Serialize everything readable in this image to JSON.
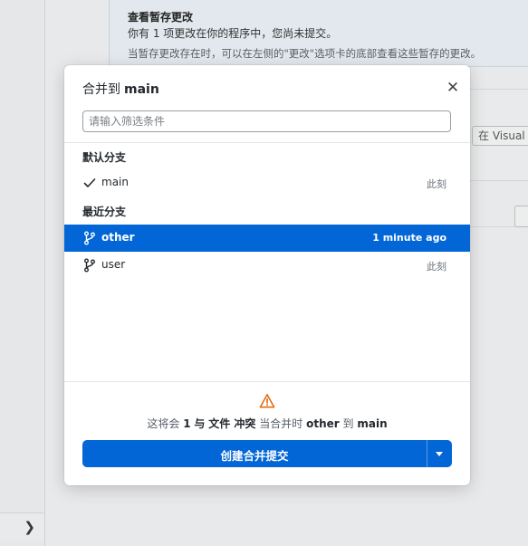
{
  "background": {
    "stash_title": "查看暂存更改",
    "stash_line1": "你有 1 项更改在你的程序中，您尚未提交。",
    "stash_line2": "当暂存更改存在时，可以在左侧的\"更改\"选项卡的底部查看这些暂存的更改。",
    "open_in_editor_label": "在 Visual S"
  },
  "dialog": {
    "title_prefix": "合并到",
    "title_branch": "main",
    "filter_placeholder": "请输入筛选条件",
    "default_group_label": "默认分支",
    "recent_group_label": "最近分支",
    "default_branches": [
      {
        "name": "main",
        "time": "此刻",
        "icon": "check-icon"
      }
    ],
    "recent_branches": [
      {
        "name": "other",
        "time": "1 minute ago",
        "icon": "git-branch-icon",
        "selected": true
      },
      {
        "name": "user",
        "time": "此刻",
        "icon": "git-branch-icon",
        "selected": false
      }
    ],
    "status": {
      "icon": "warning-icon",
      "prefix": "这将会",
      "count": "1",
      "with_word": "与",
      "files_conflict": "文件 冲突",
      "when_merging": "当合并时",
      "source_branch": "other",
      "to_word": "到",
      "target_branch": "main"
    },
    "create_button_label": "创建合并提交"
  },
  "colors": {
    "accent": "#0366d6",
    "warning": "#e36209"
  }
}
